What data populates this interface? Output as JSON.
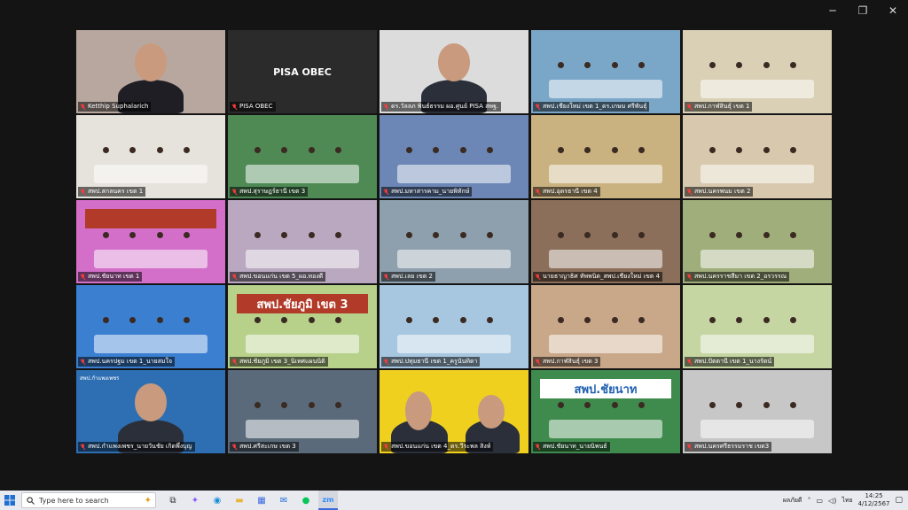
{
  "window": {
    "controls": {
      "minimize": "─",
      "restore": "❐",
      "close": "✕"
    }
  },
  "participants": [
    {
      "name": "Ketthip Suphalarich",
      "bg": "#b8a79f",
      "kind": "speaker",
      "active": false
    },
    {
      "name": "PISA OBEC",
      "bg": "#2b2b2b",
      "kind": "text",
      "label": "PISA OBEC",
      "active": false
    },
    {
      "name": "ดร.วัลลภ พินธ์ธรรม ผอ.ศูนย์ PISA สพฐ.",
      "bg": "#dcdcdc",
      "kind": "speaker2",
      "active": false
    },
    {
      "name": "สพป.เชียงใหม่ เขต 1_ดร.เกษม ศรีพันธุ์",
      "bg": "#7aa6c8",
      "kind": "temple",
      "active": true
    },
    {
      "name": "สพป.กาฬสินธุ์ เขต 1",
      "bg": "#d9d0b6",
      "kind": "room",
      "active": false
    },
    {
      "name": "สพป.สกลนคร เขต 1",
      "bg": "#e6e2dc",
      "kind": "room",
      "active": false
    },
    {
      "name": "สพป.สุราษฎร์ธานี เขต 3",
      "bg": "#4f8a55",
      "kind": "room",
      "active": false
    },
    {
      "name": "สพป.มหาสารคาม_นายพิทักษ์",
      "bg": "#6c86b5",
      "kind": "room",
      "active": false
    },
    {
      "name": "สพป.อุดรธานี เขต 4",
      "bg": "#c9b27f",
      "kind": "room",
      "active": false
    },
    {
      "name": "สพป.นครพนม เขต 2",
      "bg": "#d8c9ae",
      "kind": "room",
      "active": false
    },
    {
      "name": "สพป.ชัยนาท เขต 1",
      "bg": "#d36fc9",
      "kind": "bannerroom",
      "label": "",
      "active": false
    },
    {
      "name": "สพป.ขอนแก่น เขต 5_ผอ.ทองดี",
      "bg": "#b9a8bf",
      "kind": "room",
      "active": false
    },
    {
      "name": "สพป.เลย เขต 2",
      "bg": "#8e9fae",
      "kind": "room",
      "active": false
    },
    {
      "name": "นายธาญาธิศ ทัพพนิต_สพป.เชียงใหม่ เขต 4",
      "bg": "#8b6f5a",
      "kind": "room",
      "active": false
    },
    {
      "name": "สพป.นครราชสีมา เขต 2_อรวรรณ",
      "bg": "#9fae7a",
      "kind": "room",
      "active": false
    },
    {
      "name": "สพป.นครปฐม เขต 1_นายสมใจ",
      "bg": "#3b7fd1",
      "kind": "room",
      "active": false
    },
    {
      "name": "สพป.ชัยภูมิ เขต 3_นิเทศแผนนิติ",
      "bg": "#b8d18a",
      "kind": "bannerroom",
      "label": "สพป.ชัยภูมิ เขต 3",
      "active": false
    },
    {
      "name": "สพป.ปทุมธานี เขต 1_ครูนันทิดา",
      "bg": "#a7c7e0",
      "kind": "room",
      "active": false
    },
    {
      "name": "สพป.กาฬสินธุ์ เขต 3",
      "bg": "#c9a88a",
      "kind": "room",
      "active": false
    },
    {
      "name": "สพป.ปัตตานี เขต 1_นางรัตน์",
      "bg": "#c6d6a2",
      "kind": "room",
      "active": false
    },
    {
      "name": "สพป.กำแพงเพชร_นายวันชัย เกิดพึ่งบุญ",
      "bg": "#2e6fb3",
      "kind": "speaker3",
      "label": "สพป.กำแพงเพชร",
      "active": false
    },
    {
      "name": "สพป.ศรีสะเกษ เขต 3",
      "bg": "#5b6a7a",
      "kind": "room",
      "active": false
    },
    {
      "name": "สพป.ขอนแก่น เขต 4_ดร.วีระพล สิงห์",
      "bg": "#f0d01f",
      "kind": "speaker4",
      "active": false
    },
    {
      "name": "สพป.ชัยนาท_นายนิพนธ์",
      "bg": "#3f8b4e",
      "kind": "bannerroom2",
      "label": "สพป.ชัยนาท",
      "active": false
    },
    {
      "name": "สพป.นครศรีธรรมราช เขต3",
      "bg": "#c7c7c7",
      "kind": "room",
      "active": false
    }
  ],
  "taskbar": {
    "search_placeholder": "Type here to search",
    "apps": [
      {
        "icon": "task-view-icon",
        "glyph": "⧉",
        "color": "#333"
      },
      {
        "icon": "copilot-icon",
        "glyph": "✦",
        "color": "#8a5cf0"
      },
      {
        "icon": "edge-icon",
        "glyph": "◉",
        "color": "#1a8fd6"
      },
      {
        "icon": "file-explorer-icon",
        "glyph": "▬",
        "color": "#e8b53a"
      },
      {
        "icon": "store-icon",
        "glyph": "▦",
        "color": "#3a6ae0"
      },
      {
        "icon": "mail-icon",
        "glyph": "✉",
        "color": "#1f6fd1"
      },
      {
        "icon": "line-icon",
        "glyph": "●",
        "color": "#06c755"
      },
      {
        "icon": "zoom-icon",
        "glyph": "zm",
        "color": "#2d8cff"
      }
    ],
    "tray_label": "ผลภัยดี",
    "lang": "ไทย",
    "time": "14:25",
    "date": "4/12/2567"
  }
}
